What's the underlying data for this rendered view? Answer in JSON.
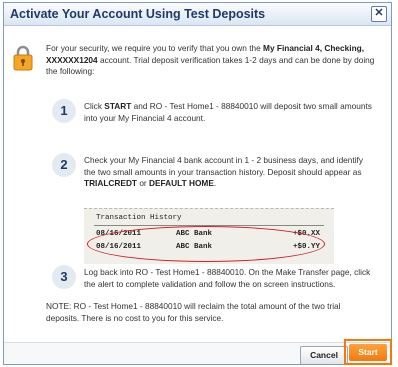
{
  "dialog": {
    "title": "Activate Your Account Using Test Deposits",
    "close_label": "✕"
  },
  "intro": {
    "p1": "For your security, we require you to verify that you own the ",
    "p1_bold": "My Financial 4, Checking, XXXXXX1204",
    "p2": " account. Trial deposit verification takes 1-2 days and can be done by doing the following:"
  },
  "steps": [
    {
      "number": "1",
      "a": "Click ",
      "a_bold": "START",
      "b": " and RO - Test Home1 - 88840010 will deposit two small amounts into your My Financial 4 account."
    },
    {
      "number": "2",
      "a": "Check your My Financial 4 bank account in 1 - 2 business days, and identify the two small amounts in your transaction history. Deposit should appear as ",
      "b_bold": "TRIALCREDT",
      "c": " or ",
      "d_bold": "DEFAULT HOME",
      "e": "."
    },
    {
      "number": "3",
      "text": "Log back into RO - Test Home1 - 88840010. On the Make Transfer page, click the alert to complete validation and follow the on screen instructions."
    }
  ],
  "transaction_history": {
    "header": "Transaction History",
    "rows": [
      {
        "date": "08/16/2011",
        "bank": "ABC Bank",
        "amount": "+$0.XX"
      },
      {
        "date": "08/16/2011",
        "bank": "ABC Bank",
        "amount": "+$0.YY"
      }
    ]
  },
  "note": "NOTE: RO - Test Home1 - 88840010 will reclaim the total amount of the two trial deposits. There is no cost to you for this service.",
  "footer": {
    "cancel_label": "Cancel",
    "start_label": "Start"
  },
  "colors": {
    "accent": "#f07a10",
    "title": "#1f3b66",
    "highlight_oval": "#cc2222"
  },
  "icons": [
    "close-icon",
    "lock-icon"
  ]
}
